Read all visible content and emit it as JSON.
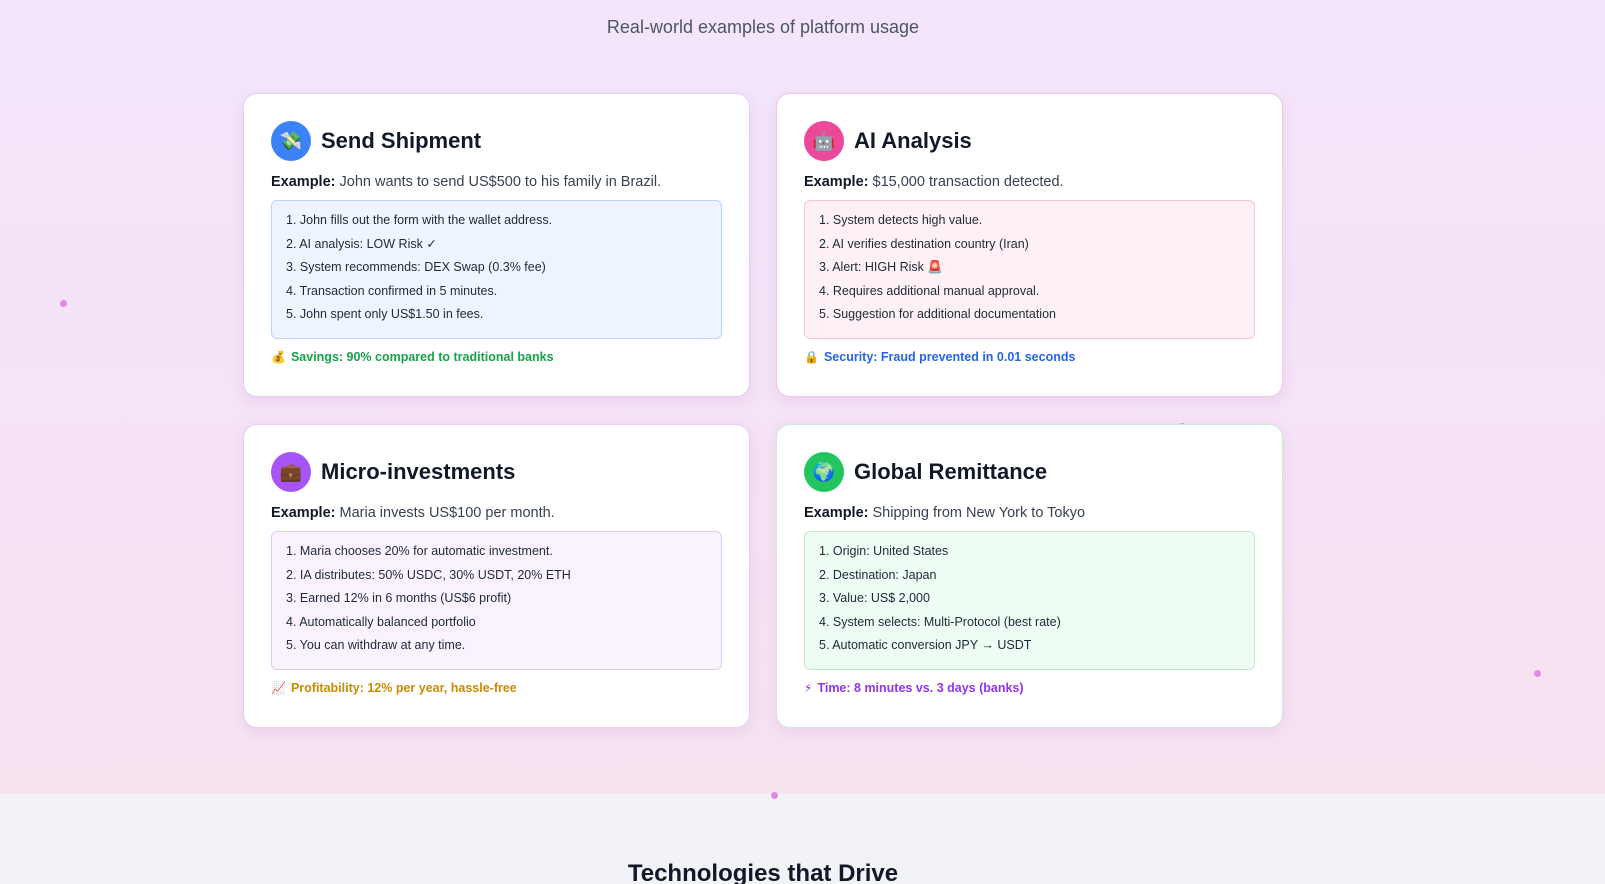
{
  "section": {
    "subtitle": "Real-world examples of platform usage",
    "next_title": "Technologies that Drive"
  },
  "cards": [
    {
      "title": "Send Shipment",
      "icon": "money-wings-icon",
      "icon_glyph": "💸",
      "icon_bg": "#3b82f6",
      "example_label": "Example:",
      "example_text": "John wants to send US$500 to his family in Brazil.",
      "steps": [
        "1. John fills out the form with the wallet address.",
        "2. AI analysis: LOW Risk ✓",
        "3. System recommends: DEX Swap (0.3% fee)",
        "4. Transaction confirmed in 5 minutes.",
        "5. John spent only US$1.50 in fees."
      ],
      "note_icon": "money-bag-icon",
      "note_glyph": "💰",
      "note": "Savings: 90% compared to traditional banks",
      "note_color": "#16a34a"
    },
    {
      "title": "AI Analysis",
      "icon": "robot-icon",
      "icon_glyph": "🤖",
      "icon_bg": "#ec4899",
      "example_label": "Example:",
      "example_text": "$15,000 transaction detected.",
      "steps": [
        "1. System detects high value.",
        "2. AI verifies destination country (Iran)",
        "3. Alert: HIGH Risk 🚨",
        "4. Requires additional manual approval.",
        "5. Suggestion for additional documentation"
      ],
      "note_icon": "lock-icon",
      "note_glyph": "🔒",
      "note": "Security: Fraud prevented in 0.01 seconds",
      "note_color": "#2563eb"
    },
    {
      "title": "Micro-investments",
      "icon": "briefcase-icon",
      "icon_glyph": "💼",
      "icon_bg": "#a855f7",
      "example_label": "Example:",
      "example_text": "Maria invests US$100 per month.",
      "steps": [
        "1. Maria chooses 20% for automatic investment.",
        "2. IA distributes: 50% USDC, 30% USDT, 20% ETH",
        "3. Earned 12% in 6 months (US$6 profit)",
        "4. Automatically balanced portfolio",
        "5. You can withdraw at any time."
      ],
      "note_icon": "chart-up-icon",
      "note_glyph": "📈",
      "note": "Profitability: 12% per year, hassle-free",
      "note_color": "#ca8a04"
    },
    {
      "title": "Global Remittance",
      "icon": "globe-icon",
      "icon_glyph": "🌍",
      "icon_bg": "#22c55e",
      "example_label": "Example:",
      "example_text": "Shipping from New York to Tokyo",
      "steps": [
        "1. Origin: United States",
        "2. Destination: Japan",
        "3. Value: US$ 2,000",
        "4. System selects: Multi-Protocol (best rate)",
        "5. Automatic conversion JPY → USDT"
      ],
      "note_icon": "lightning-icon",
      "note_glyph": "⚡",
      "note": "Time: 8 minutes vs. 3 days (banks)",
      "note_color": "#9333ea"
    }
  ]
}
